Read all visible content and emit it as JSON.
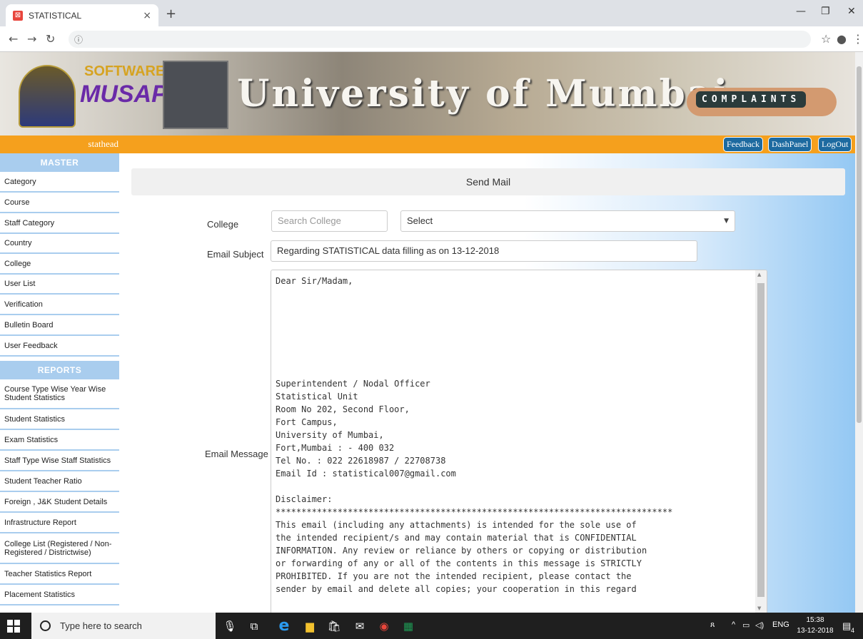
{
  "browser": {
    "tab_title": "STATISTICAL",
    "tab_close": "×",
    "new_tab": "+",
    "url": "",
    "icons": [
      "back-icon",
      "forward-icon",
      "reload-icon",
      "info-icon",
      "star-icon",
      "profile-icon",
      "menu-icon"
    ]
  },
  "header": {
    "logo_line1": "SOFTWARE",
    "logo_line2": "MUSAP",
    "banner_title": "University of Mumbai",
    "banner_tags": "COMPLAINTS",
    "username": "stathead",
    "buttons": [
      "Feedback",
      "DashPanel",
      "LogOut"
    ]
  },
  "sidebar": {
    "master_title": "MASTER",
    "master_items": [
      "Category",
      "Course",
      "Staff Category",
      "Country",
      "College",
      "User List",
      "Verification",
      "Bulletin Board",
      "User Feedback"
    ],
    "reports_title": "REPORTS",
    "reports_items": [
      "Course Type Wise Year Wise Student Statistics",
      "Student Statistics",
      "Exam Statistics",
      "Staff Type Wise Staff Statistics",
      "Student Teacher Ratio",
      "Foreign , J&K Student Details",
      "Infrastructure Report",
      "College List (Registered / Non-Registered / Districtwise)",
      "Teacher Statistics Report",
      "Placement Statistics"
    ]
  },
  "form": {
    "title": "Send Mail",
    "college_label": "College",
    "college_search_placeholder": "Search College",
    "college_select_value": "Select",
    "subject_label": "Email Subject",
    "subject_value": "Regarding STATISTICAL data filling as on 13-12-2018",
    "message_label": "Email Message",
    "message_value": "Dear Sir/Madam,\n\n\n\n\n\n\n\nSuperintendent / Nodal Officer\nStatistical Unit\nRoom No 202, Second Floor,\nFort Campus,\nUniversity of Mumbai,\nFort,Mumbai : - 400 032\nTel No. : 022 22618987 / 22708738\nEmail Id : statistical007@gmail.com\n\nDisclaimer:\n*****************************************************************************\nThis email (including any attachments) is intended for the sole use of\nthe intended recipient/s and may contain material that is CONFIDENTIAL\nINFORMATION. Any review or reliance by others or copying or distribution\nor forwarding of any or all of the contents in this message is STRICTLY\nPROHIBITED. If you are not the intended recipient, please contact the\nsender by email and delete all copies; your cooperation in this regard"
  },
  "taskbar": {
    "search_placeholder": "Type here to search",
    "lang": "ENG",
    "time": "15:38",
    "date": "13-12-2018",
    "notification_count": "4"
  }
}
